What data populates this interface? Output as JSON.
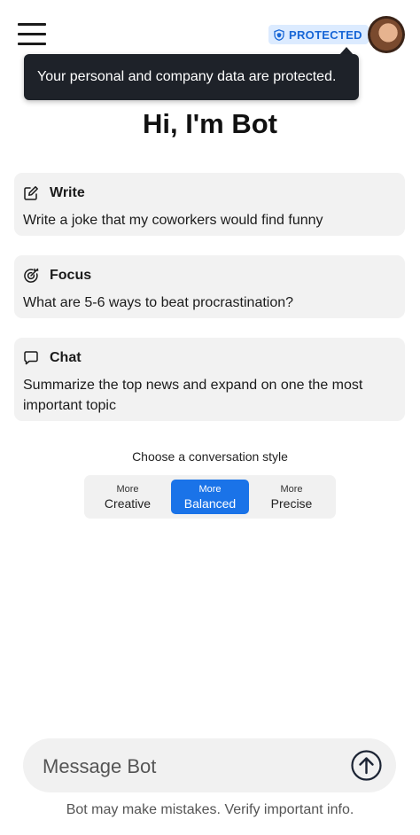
{
  "header": {
    "protected_label": "PROTECTED",
    "tooltip": "Your personal and company data are protected."
  },
  "greeting": "Hi, I'm Bot",
  "cards": [
    {
      "title": "Write",
      "text": "Write a joke that my coworkers would find funny",
      "icon": "pencil-square-icon"
    },
    {
      "title": "Focus",
      "text": "What are 5-6 ways to beat procrastination?",
      "icon": "target-icon"
    },
    {
      "title": "Chat",
      "text": "Summarize the top news and expand on one the most important topic",
      "icon": "chat-bubble-icon"
    }
  ],
  "conversation_style": {
    "caption": "Choose a conversation style",
    "options": [
      {
        "small": "More",
        "label": "Creative",
        "selected": false
      },
      {
        "small": "More",
        "label": "Balanced",
        "selected": true
      },
      {
        "small": "More",
        "label": "Precise",
        "selected": false
      }
    ]
  },
  "composer": {
    "placeholder": "Message Bot",
    "disclaimer": "Bot may make mistakes. Verify important info."
  },
  "colors": {
    "accent": "#1a73e8",
    "badge_bg": "#dcebff",
    "badge_text": "#1766d6",
    "tooltip_bg": "#1e2229",
    "card_bg": "#f2f2f2"
  }
}
